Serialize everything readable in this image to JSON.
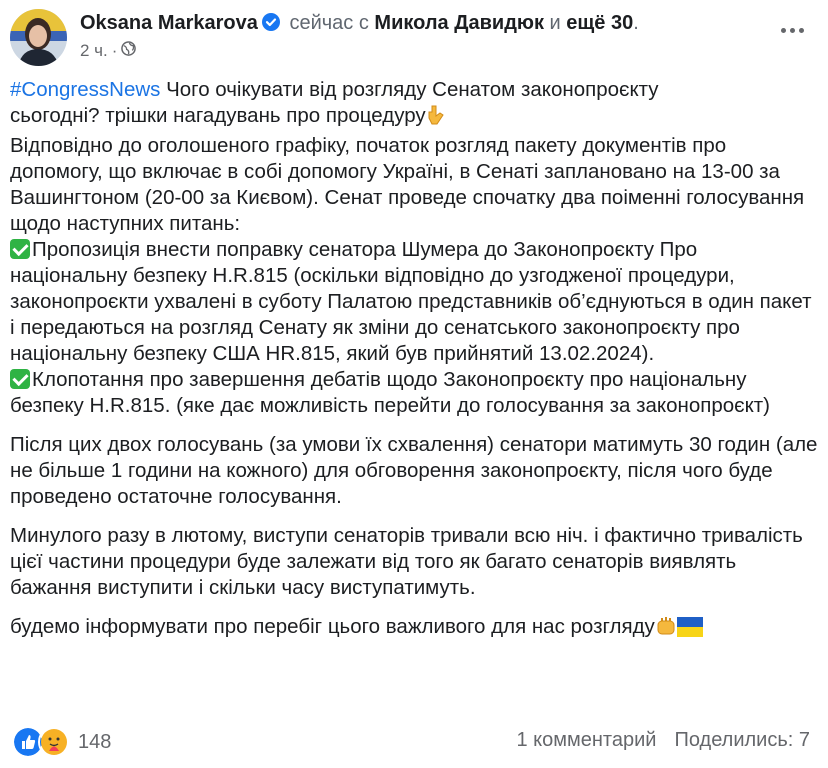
{
  "post": {
    "author": "Oksana Markarova",
    "with_text": "сейчас с",
    "tagged_person": "Микола Давидюк",
    "and_text": "и",
    "others_text": "ещё 30",
    "time": "2 ч.",
    "separator": "·",
    "audience_icon": "globe-icon",
    "paragraphs": {
      "p1_hashtag": "#CongressNews",
      "p1_line1": "  Чого очікувати від розгляду Сенатом законопроєкту",
      "p1_line2": "сьогодні? трішки нагадувань про процедуру",
      "p1_rest": "Відповідно до оголошеного графіку, початок розгляд пакету документів про допомогу, що включає в собі допомогу Україні, в Сенаті заплановано на 13-00 за Вашингтоном (20-00 за Києвом). Сенат проведе спочатку два поіменні голосування щодо наступних питань:",
      "item1": "Пропозиція внести поправку сенатора Шумера до Законопроєкту Про національну безпеку H.R.815 (оскільки відповідно до узгодженої  процедури, законопроєкти ухвалені в суботу Палатою представників об’єднуються в один пакет і передаються на розгляд Сенату як зміни до сенатського законопроєкту про національну безпеку США HR.815, який був прийнятий 13.02.2024).",
      "item2": "Клопотання про завершення дебатів щодо Законопроєкту про національну безпеку H.R.815. (яке дає можливість перейти до голосування за законопроєкт)",
      "p2": "Після цих двох голосувань (за умови їх схвалення) сенатори матимуть 30 годин (але не більше 1 години на кожного) для обговорення законопроєкту, після чого буде проведено остаточне голосування.",
      "p3": "Минулого разу в лютому, виступи сенаторів тривали всю ніч. і фактично тривалість цієї частини процедури буде залежати від того як багато сенаторів виявлять бажання виступити і скільки часу виступатимуть.",
      "p4": "будемо інформувати про перебіг цього важливого для нас розгляду"
    },
    "reactions": {
      "icons": [
        "like-icon",
        "care-icon"
      ],
      "count": "148"
    },
    "comments": "1 комментарий",
    "shares": "Поделились: 7"
  }
}
